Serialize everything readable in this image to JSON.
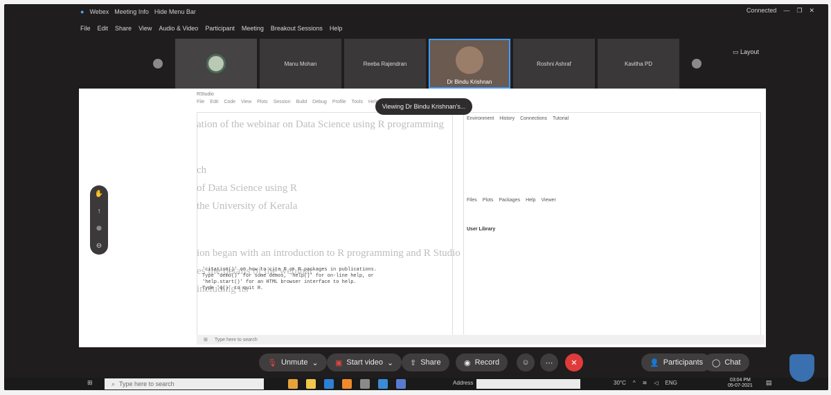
{
  "titlebar": {
    "app": "Webex",
    "meeting_info": "Meeting Info",
    "hide_menu": "Hide Menu Bar",
    "connected": "Connected",
    "minimize": "—",
    "maximize": "❐",
    "close": "✕"
  },
  "menu": [
    "File",
    "Edit",
    "Share",
    "View",
    "Audio & Video",
    "Participant",
    "Meeting",
    "Breakout Sessions",
    "Help"
  ],
  "participants": [
    {
      "name": "Manu Mohan"
    },
    {
      "name": "Reeba Rajendran"
    },
    {
      "name": "Dr Bindu Krishnan"
    },
    {
      "name": "Roshni Ashraf"
    },
    {
      "name": "Kavitha PD"
    }
  ],
  "layout_label": "Layout",
  "viewing_label": "Viewing Dr Bindu Krishnan's...",
  "shared_screen": {
    "rstudio_title": "RStudio",
    "menu": [
      "File",
      "Edit",
      "Code",
      "View",
      "Plots",
      "Session",
      "Build",
      "Debug",
      "Profile",
      "Tools",
      "Help"
    ],
    "pane_tabs": [
      "Environment",
      "History",
      "Connections",
      "Tutorial"
    ],
    "files_tabs": [
      "Files",
      "Plots",
      "Packages",
      "Help",
      "Viewer"
    ],
    "library_title": "User Library",
    "console_lines": [
      "'citation()' on how to cite R or R packages in publications.",
      "Type 'demo()' for some demos, 'help()' for on-line help, or",
      "'help.start()' for an HTML browser interface to help.",
      "Type 'q()' to quit R."
    ],
    "ghost_lines": [
      "ation of the webinar on Data Science using R programming",
      "ch",
      "of Data Science using R",
      "the University of Kerala",
      "ion began with an introduction to R programming and R Studio",
      "es the details of the webinar",
      "including its"
    ],
    "inner_search": "Type here to search"
  },
  "controls": {
    "unmute": "Unmute",
    "start_video": "Start video",
    "share": "Share",
    "record": "Record",
    "participants": "Participants",
    "chat": "Chat"
  },
  "taskbar": {
    "search_placeholder": "Type here to search",
    "address": "Address",
    "temp": "30°C",
    "lang": "ENG",
    "time": "03:04 PM",
    "date": "05-07-2021"
  }
}
